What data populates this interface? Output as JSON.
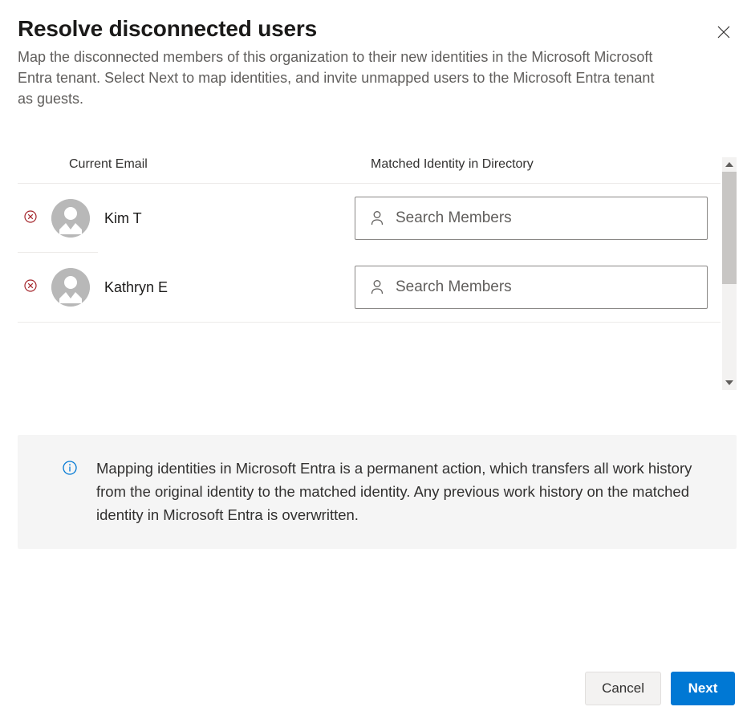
{
  "header": {
    "title": "Resolve disconnected users",
    "subtitle": "Map the disconnected members of this organization to their new identities in the Microsoft Microsoft Entra tenant. Select Next to map identities, and invite unmapped users to the Microsoft Entra tenant as guests."
  },
  "columns": {
    "email": "Current Email",
    "matched": "Matched Identity in Directory"
  },
  "users": [
    {
      "name": "Kim T",
      "search_placeholder": "Search Members"
    },
    {
      "name": "Kathryn E",
      "search_placeholder": "Search Members"
    }
  ],
  "info_banner": {
    "text": "Mapping identities in Microsoft Entra is a permanent action, which transfers all work history from the original identity to the matched identity. Any previous work history on the matched identity in Microsoft Entra is overwritten."
  },
  "footer": {
    "cancel": "Cancel",
    "next": "Next"
  }
}
